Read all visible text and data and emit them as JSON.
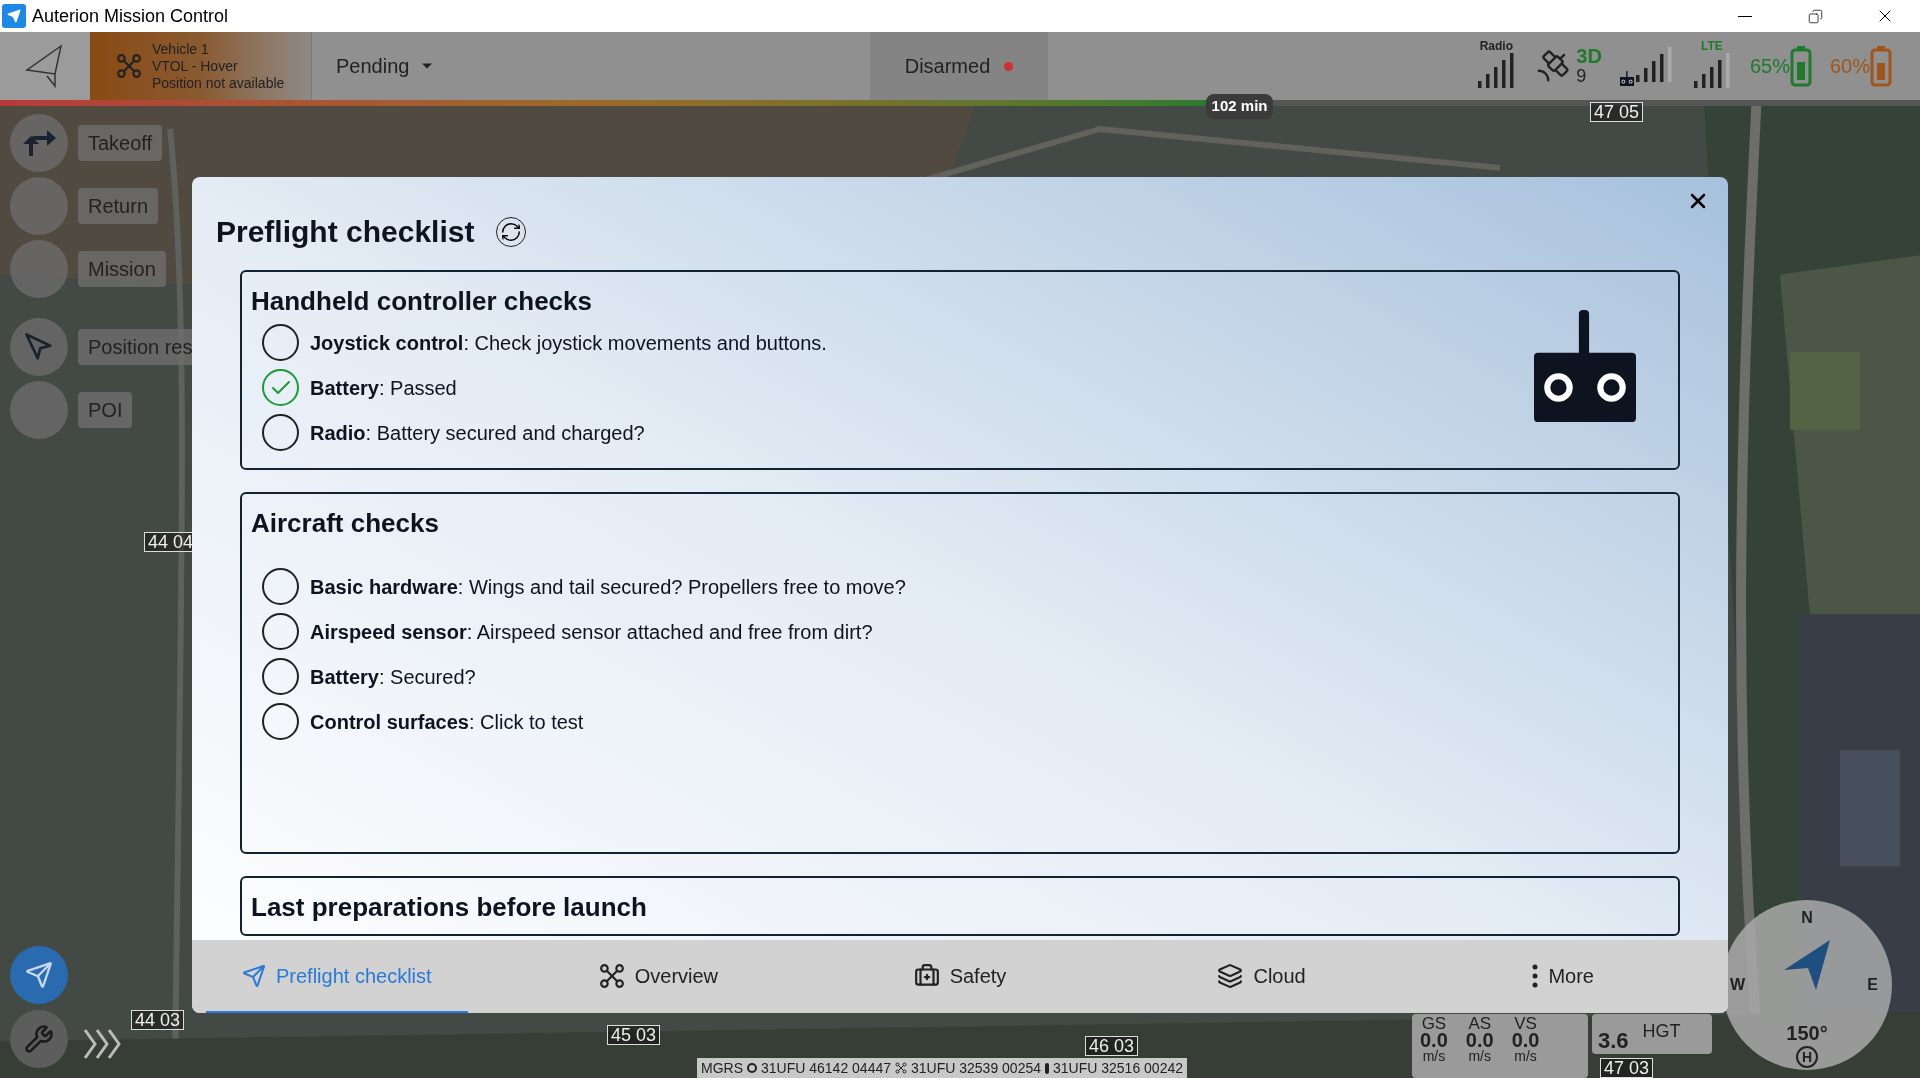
{
  "window": {
    "title": "Auterion Mission Control"
  },
  "top_bar": {
    "vehicle": {
      "name": "Vehicle 1",
      "mode": "VTOL - Hover",
      "position": "Position not available"
    },
    "flight_mode": "Pending",
    "arm_state": "Disarmed",
    "radio_label": "Radio",
    "gps_fix": "3D",
    "satellites": "9",
    "lte_label": "LTE",
    "vehicle_battery": "65%",
    "controller_battery": "60%"
  },
  "flight_time": {
    "level": 0.63,
    "reading": "102 min"
  },
  "actions": [
    {
      "label": "Takeoff"
    },
    {
      "label": "Return"
    },
    {
      "label": "Mission"
    },
    {
      "label": "Position res"
    },
    {
      "label": "POI"
    }
  ],
  "grid_labels": [
    "47 05",
    "44 04",
    "44 03",
    "45 03",
    "46 03",
    "47 03"
  ],
  "dialog": {
    "title": "Preflight checklist",
    "sections": [
      {
        "title": "Handheld controller checks",
        "items": [
          {
            "text": "**Joystick control**: Check joystick movements and buttons.",
            "checked": false
          },
          {
            "text": "**Battery**: Passed",
            "checked": true
          },
          {
            "text": "**Radio**: Battery secured and charged?",
            "checked": false
          }
        ]
      },
      {
        "title": "Aircraft checks",
        "items": [
          {
            "text": "**Basic hardware**: Wings and tail secured? Propellers free to move?",
            "checked": false
          },
          {
            "text": "**Airspeed sensor**: Airspeed sensor attached and free from dirt?",
            "checked": false
          },
          {
            "text": "**Battery**: Secured?",
            "checked": false
          },
          {
            "text": "**Control surfaces**: Click to test",
            "checked": false
          }
        ]
      },
      {
        "title": "Last preparations before launch"
      }
    ],
    "tabs": [
      {
        "label": "Preflight checklist",
        "selected": true
      },
      {
        "label": "Overview",
        "selected": false
      },
      {
        "label": "Safety",
        "selected": false
      },
      {
        "label": "Cloud",
        "selected": false
      },
      {
        "label": "More",
        "selected": false
      }
    ]
  },
  "telemetry": [
    {
      "label": "GS",
      "value": "0.0",
      "unit": "m/s"
    },
    {
      "label": "AS",
      "value": "0.0",
      "unit": "m/s"
    },
    {
      "label": "VS",
      "value": "0.0",
      "unit": "m/s"
    }
  ],
  "height": {
    "value": "3.6",
    "label": "HGT"
  },
  "compass": {
    "north": "N",
    "east": "E",
    "west": "W",
    "heading": "150°",
    "home": "H"
  },
  "coordinates": {
    "system": "MGRS",
    "vehicle": "31UFU 46142 04447",
    "drone": "31UFU 32539 00254",
    "pilot": "31UFU 32516 00242"
  }
}
